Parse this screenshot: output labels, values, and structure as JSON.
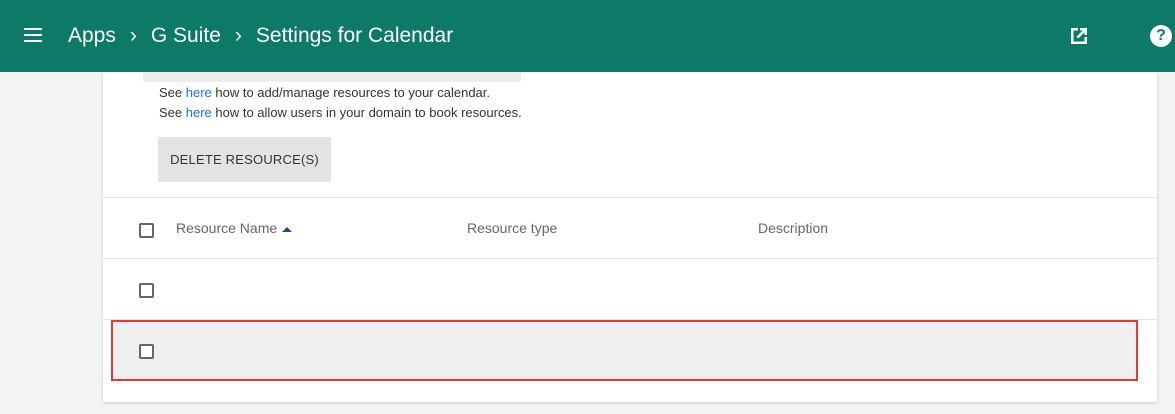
{
  "header": {
    "breadcrumb": [
      "Apps",
      "G Suite",
      "Settings for Calendar"
    ],
    "separator": "›",
    "help_glyph": "?",
    "icons": [
      "menu-icon",
      "open-in-new-icon",
      "help-icon"
    ],
    "background_color": "#0d7a68"
  },
  "help_text": {
    "line1": {
      "prefix": "See ",
      "link": "here",
      "suffix": " how to add/manage resources to your calendar."
    },
    "line2": {
      "prefix": "See ",
      "link": "here",
      "suffix": " how to allow users in your domain to book resources."
    }
  },
  "toolbar": {
    "delete_label": "DELETE RESOURCE(S)"
  },
  "table": {
    "columns": [
      "Resource Name",
      "Resource type",
      "Description"
    ],
    "sorted_column": "Resource Name",
    "sort_direction": "ascending",
    "rows": [
      {
        "name": "",
        "type": "",
        "description": "",
        "selected": false
      },
      {
        "name": "",
        "type": "",
        "description": "",
        "selected": true
      }
    ]
  },
  "colors": {
    "link": "#1a73e8",
    "highlight": "#e53935"
  }
}
